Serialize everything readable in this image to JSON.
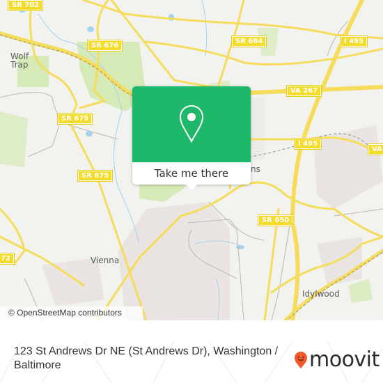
{
  "map": {
    "road_shields": [
      {
        "label": "SR 702"
      },
      {
        "label": "SR 676"
      },
      {
        "label": "SR 684"
      },
      {
        "label": "I 495"
      },
      {
        "label": "VA 267"
      },
      {
        "label": "SR 675"
      },
      {
        "label": "I 495"
      },
      {
        "label": "VA"
      },
      {
        "label": "SR 675"
      },
      {
        "label": "SR 650"
      },
      {
        "label": "72"
      }
    ],
    "places": [
      {
        "label": "Wolf\nTrap"
      },
      {
        "label": "Vienna"
      },
      {
        "label": "Idylwood"
      },
      {
        "label": "ns"
      }
    ],
    "attribution": "© OpenStreetMap contributors",
    "colors": {
      "background": "#f2f2ef",
      "road": "#f5dc5a",
      "park": "#d6eab8",
      "water": "#a7d2ee",
      "residential": "#e9e3e0"
    }
  },
  "popup": {
    "icon": "map-pin-icon",
    "button_label": "Take me there",
    "accent_color": "#1fb86a"
  },
  "footer": {
    "address": "123 St Andrews Dr NE (St Andrews Dr), Washington / Baltimore",
    "brand": "moovit",
    "brand_icon": "moovit-pin-logo-icon",
    "brand_color": "#f0592a"
  }
}
